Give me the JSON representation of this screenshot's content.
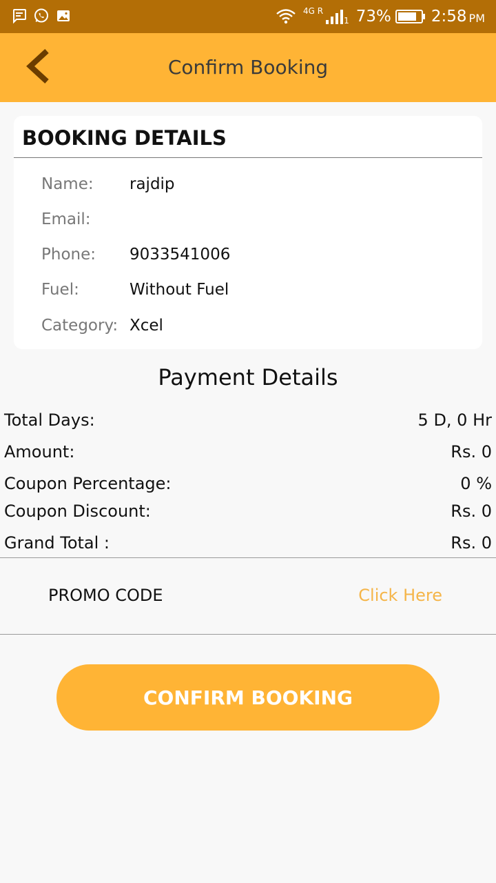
{
  "status_bar": {
    "network": "4G R",
    "sim_slot": "1",
    "battery": "73%",
    "time": "2:58",
    "ampm": "PM",
    "icons": [
      "message-icon",
      "whatsapp-icon",
      "image-icon",
      "wifi-icon",
      "signal-icon",
      "battery-icon"
    ]
  },
  "header": {
    "title": "Confirm Booking",
    "back_icon": "chevron-left-icon"
  },
  "booking": {
    "title": "BOOKING DETAILS",
    "rows": [
      {
        "label": "Name:",
        "value": "rajdip"
      },
      {
        "label": "Email:",
        "value": ""
      },
      {
        "label": "Phone:",
        "value": "9033541006"
      },
      {
        "label": "Fuel:",
        "value": "Without Fuel"
      },
      {
        "label": "Category:",
        "value": "Xcel"
      }
    ]
  },
  "payment": {
    "title": "Payment Details",
    "rows": [
      {
        "label": "Total Days:",
        "value": "5 D, 0 Hr"
      },
      {
        "label": "Amount:",
        "value": "Rs. 0"
      },
      {
        "label": "Coupon Percentage:",
        "value": "0 %"
      },
      {
        "label": "Coupon Discount:",
        "value": "Rs. 0"
      },
      {
        "label": "Grand Total :",
        "value": "Rs. 0"
      }
    ]
  },
  "promo": {
    "label": "PROMO CODE",
    "link": "Click Here"
  },
  "confirm_button": "CONFIRM BOOKING",
  "colors": {
    "status_bar": "#b36e06",
    "accent": "#ffb435",
    "link": "#f5b549",
    "back_icon": "#6b3d00"
  }
}
